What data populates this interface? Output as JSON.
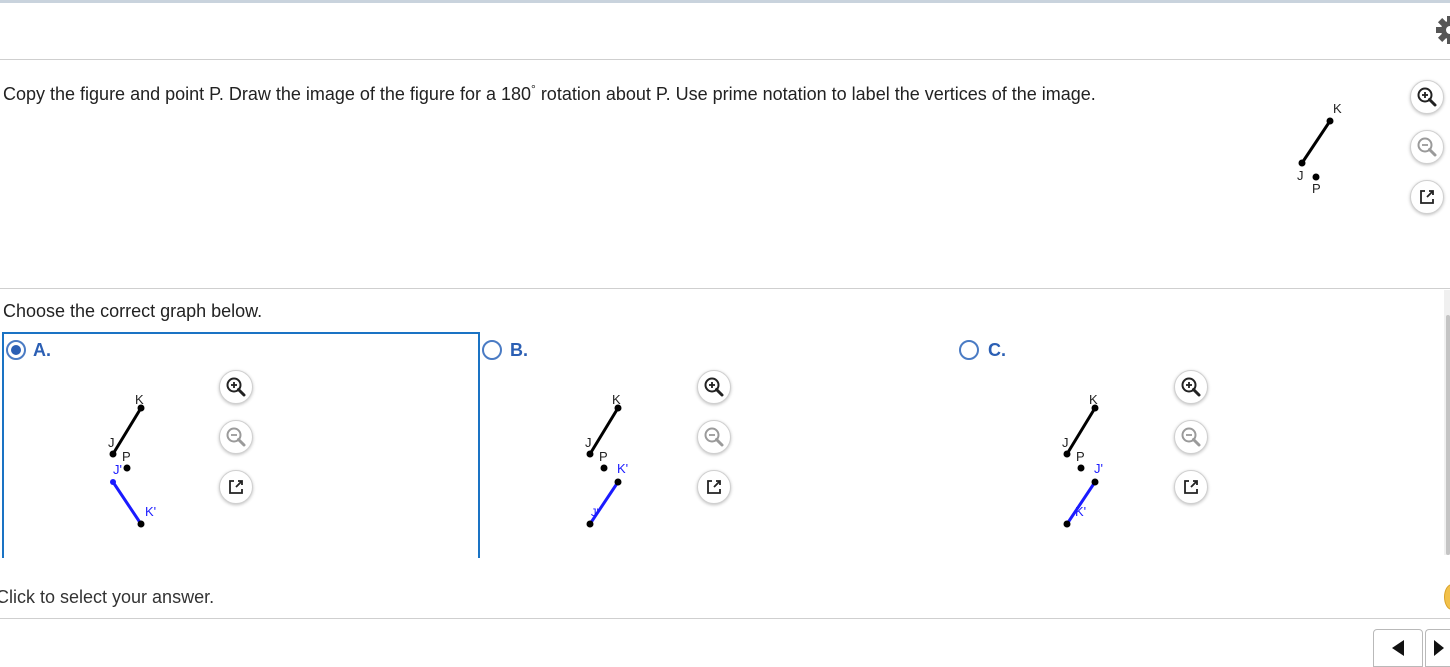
{
  "question": {
    "text_before": "Copy the figure and point P. Draw the image of the figure for a 180",
    "degree_symbol": "°",
    "text_after": " rotation about P. Use prime notation to label the vertices of the image."
  },
  "figure": {
    "labels": {
      "k": "K",
      "j": "J",
      "p": "P"
    }
  },
  "prompt": "Choose the correct graph below.",
  "options": [
    {
      "letter": "A.",
      "selected": true,
      "labels": {
        "k": "K",
        "j": "J",
        "p": "P",
        "jp": "J'",
        "kp": "K'"
      }
    },
    {
      "letter": "B.",
      "selected": false,
      "labels": {
        "k": "K",
        "j": "J",
        "p": "P",
        "kp": "K'",
        "jp": "J'"
      }
    },
    {
      "letter": "C.",
      "selected": false,
      "labels": {
        "k": "K",
        "j": "J",
        "p": "P",
        "jp": "J'",
        "kp": "K'"
      }
    }
  ],
  "footer": {
    "instruction": "Click to select your answer."
  },
  "colors": {
    "original_segment": "#000000",
    "image_segment": "#1a1aff",
    "accent": "#2b5fb4",
    "selected_border": "#1a73c4"
  },
  "icons": {
    "zoom_in": "zoom-in-icon",
    "zoom_out": "zoom-out-icon",
    "popout": "popout-icon",
    "settings": "gear-icon",
    "prev": "prev-arrow-icon",
    "next": "next-arrow-icon"
  }
}
